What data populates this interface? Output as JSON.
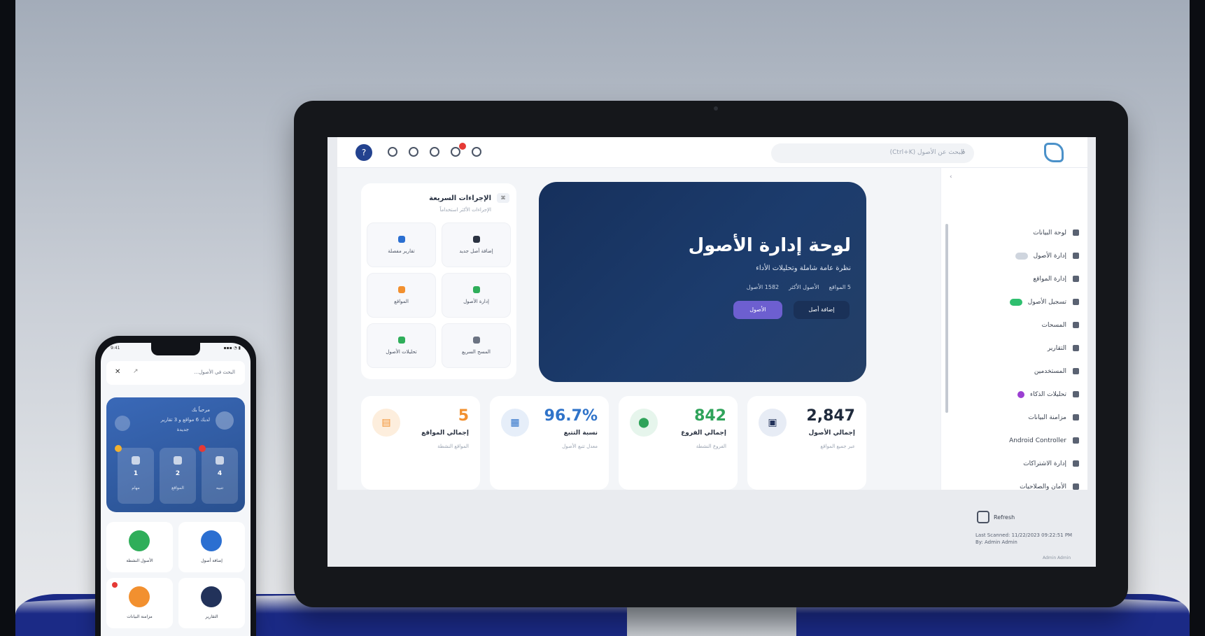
{
  "topbar": {
    "avatar_initial": "?",
    "search_placeholder": "البحث عن الأصول (Ctrl+K)"
  },
  "sidebar": {
    "items": [
      {
        "label": "لوحة البيانات",
        "tag": ""
      },
      {
        "label": "إدارة الأصول",
        "tag": "gray"
      },
      {
        "label": "إدارة المواقع",
        "tag": ""
      },
      {
        "label": "تسجيل الأصول",
        "tag": "green"
      },
      {
        "label": "المسحات",
        "tag": ""
      },
      {
        "label": "التقارير",
        "tag": ""
      },
      {
        "label": "المستخدمين",
        "tag": ""
      },
      {
        "label": "تحليلات الذكاء",
        "tag": "purple"
      },
      {
        "label": "مزامنة البيانات",
        "tag": ""
      },
      {
        "label": "Android Controller",
        "tag": ""
      },
      {
        "label": "إدارة الاشتراكات",
        "tag": ""
      },
      {
        "label": "الأمان والصلاحيات",
        "tag": ""
      }
    ]
  },
  "hero": {
    "title": "لوحة إدارة الأصول",
    "subtitle": "نظرة عامة شاملة وتحليلات الأداء",
    "meta": [
      "5 المواقع",
      "الأصول الأكثر",
      "1582 الأصول"
    ],
    "btn_primary": "الأصول",
    "btn_secondary": "إضافة أصل"
  },
  "quick_actions": {
    "title": "الإجراءات السريعة",
    "subtitle": "الإجراءات الأكثر استخداماً",
    "icon_label": "⌘",
    "items": [
      {
        "label": "إضافة أصل جديد",
        "color": "#2b3342"
      },
      {
        "label": "تقارير مفصلة",
        "color": "#2b6fd1"
      },
      {
        "label": "إدارة الأصول",
        "color": "#2fae5a"
      },
      {
        "label": "المواقع",
        "color": "#f2902f"
      },
      {
        "label": "المسح السريع",
        "color": "#6b7382"
      },
      {
        "label": "تحليلات الأصول",
        "color": "#2fae5a"
      }
    ]
  },
  "stats": [
    {
      "value": "2,847",
      "label": "إجمالي الأصول",
      "note": "عبر جميع المواقع",
      "color": "#1f2a3c",
      "icon": "▣",
      "icon_bg": "#e7ecf5",
      "icon_color": "#22325a"
    },
    {
      "value": "842",
      "label": "إجمالي الفروع",
      "note": "الفروع النشطة",
      "color": "#2fa35a",
      "icon": "⬤",
      "icon_bg": "#e6f5ec",
      "icon_color": "#2fa35a"
    },
    {
      "value": "96.7%",
      "label": "نسبة التتبع",
      "note": "معدل تتبع الأصول",
      "color": "#2f73c9",
      "icon": "▦",
      "icon_bg": "#e6eef9",
      "icon_color": "#2f73c9"
    },
    {
      "value": "5",
      "label": "إجمالي المواقع",
      "note": "المواقع النشطة",
      "color": "#f2902f",
      "icon": "▤",
      "icon_bg": "#fdeedd",
      "icon_color": "#f2902f"
    }
  ],
  "footer": {
    "refresh_label": "Refresh",
    "last_line1": "Last Scanned: 11/22/2023 09:22:51 PM",
    "last_line2": "By: Admin Admin",
    "admin_label": "Admin Admin"
  },
  "phone": {
    "time": "9:41",
    "status_right": "▪▪▪ ◔ ▮",
    "search_text": "البحث في الأصول...",
    "card_title": "مرحباً بك",
    "card_line2": "لديك 6 مواقع و 3 تقارير",
    "card_line3": "جديدة",
    "minis": [
      {
        "num": "4",
        "label": "تنبيه",
        "badge": "#e53935"
      },
      {
        "num": "2",
        "label": "المواقع",
        "badge": ""
      },
      {
        "num": "1",
        "label": "مهام",
        "badge": "#f2b12f"
      }
    ],
    "tiles": [
      {
        "label": "الأصول النشطة",
        "color": "#2fae5a",
        "dot": false
      },
      {
        "label": "إضافة أصول",
        "color": "#2b6fd1",
        "dot": false
      },
      {
        "label": "مزامنة البيانات",
        "color": "#f2902f",
        "dot": true
      },
      {
        "label": "التقارير",
        "color": "#22325a",
        "dot": false
      }
    ]
  }
}
